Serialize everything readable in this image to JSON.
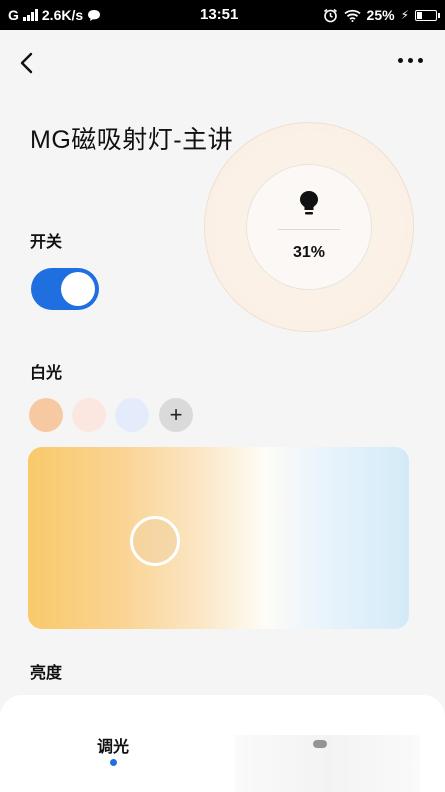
{
  "status_bar": {
    "network_label": "G",
    "speed": "2.6K/s",
    "time": "13:51",
    "battery": "25%"
  },
  "header": {
    "title": "MG磁吸射灯-主讲"
  },
  "brightness_ring": {
    "percent": "31%",
    "level": 0.31
  },
  "power": {
    "label": "开关",
    "on": true
  },
  "white_light": {
    "label": "白光",
    "swatches": [
      "#f7c9a3",
      "#fbe7df",
      "#e4ebfb"
    ],
    "add_label": "+"
  },
  "color_temperature": {
    "gradient_colors": [
      "#f9c96a",
      "#fefcf6",
      "#d4eaf8"
    ]
  },
  "brightness": {
    "label": "亮度"
  },
  "bottom_tabs": {
    "active_label": "调光"
  },
  "colors": {
    "accent": "#1f6fe0",
    "background": "#f5f5f5"
  }
}
